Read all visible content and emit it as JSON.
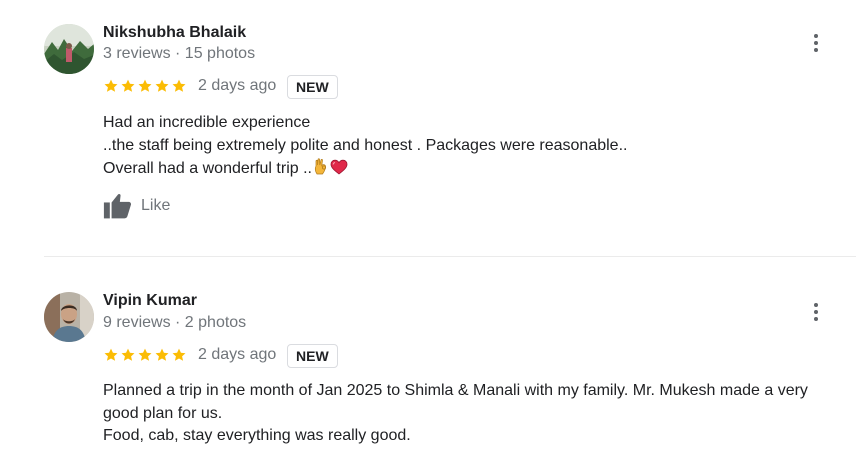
{
  "reviews": [
    {
      "name": "Nikshubha Bhalaik",
      "meta": "3 reviews · 15 photos",
      "rating": 5,
      "time": "2 days ago",
      "badge": "NEW",
      "lines": [
        "Had an incredible experience",
        "..the staff being extremely polite and honest . Packages were reasonable..",
        "Overall had a wonderful trip .."
      ],
      "trailing_emoji": [
        "ok-hand-emoji",
        "heart-emoji"
      ],
      "like_label": "Like"
    },
    {
      "name": "Vipin Kumar",
      "meta": "9 reviews · 2 photos",
      "rating": 5,
      "time": "2 days ago",
      "badge": "NEW",
      "lines": [
        "Planned a trip in the month of Jan 2025 to Shimla & Manali with my family. Mr. Mukesh made a very good plan for us.",
        "Food, cab, stay everything was really good."
      ]
    }
  ],
  "colors": {
    "star": "#fbbc04",
    "secondary_text": "#70757a",
    "primary_text": "#202124",
    "divider": "#ebebeb"
  }
}
